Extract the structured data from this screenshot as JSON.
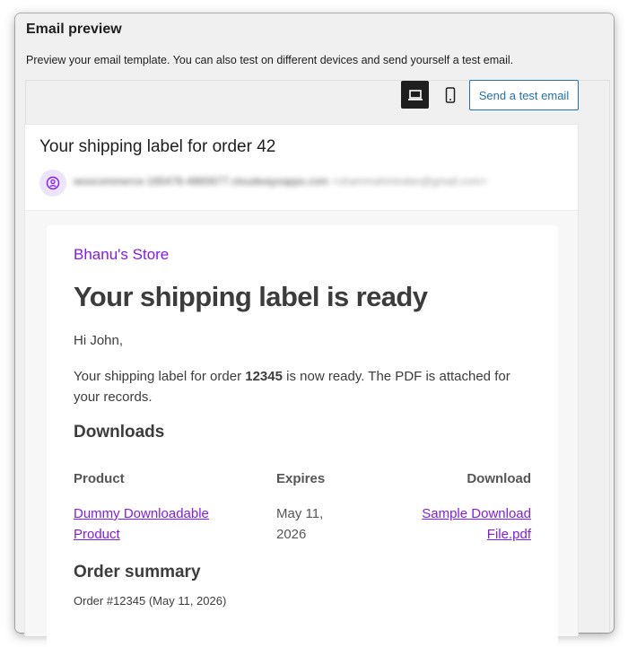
{
  "panel": {
    "title": "Email preview",
    "description": "Preview your email template. You can also test on different devices and send yourself a test email."
  },
  "toolbar": {
    "desktop_icon": "laptop-icon",
    "mobile_icon": "mobile-icon",
    "send_test_label": "Send a test email",
    "accent_color": "#2271b1"
  },
  "email": {
    "subject": "Your shipping label for order 42",
    "sender_name": "woocommerce-165476-4865677.cloudwaysapps.com",
    "sender_address": "<shammahmindan@gmail.com>",
    "sender_icon": "user-circle-icon",
    "store_name": "Bhanu's Store",
    "brand_color": "#7f1bf5",
    "headline": "Your shipping label is ready",
    "greeting": "Hi John,",
    "message_before": "Your shipping label for order ",
    "order_number": "12345",
    "message_after": " is now ready. The PDF is attached for your records.",
    "downloads_heading": "Downloads",
    "downloads_table": {
      "headers": {
        "product": "Product",
        "expires": "Expires",
        "download": "Download"
      },
      "rows": [
        {
          "product_line1": "Dummy Downloadable",
          "product_line2": "Product",
          "expires_line1": "May 11,",
          "expires_line2": "2026",
          "download_line1": "Sample Download",
          "download_line2": "File.pdf"
        }
      ]
    },
    "order_summary_heading": "Order summary",
    "order_meta": "Order #12345 (May 11, 2026)"
  }
}
